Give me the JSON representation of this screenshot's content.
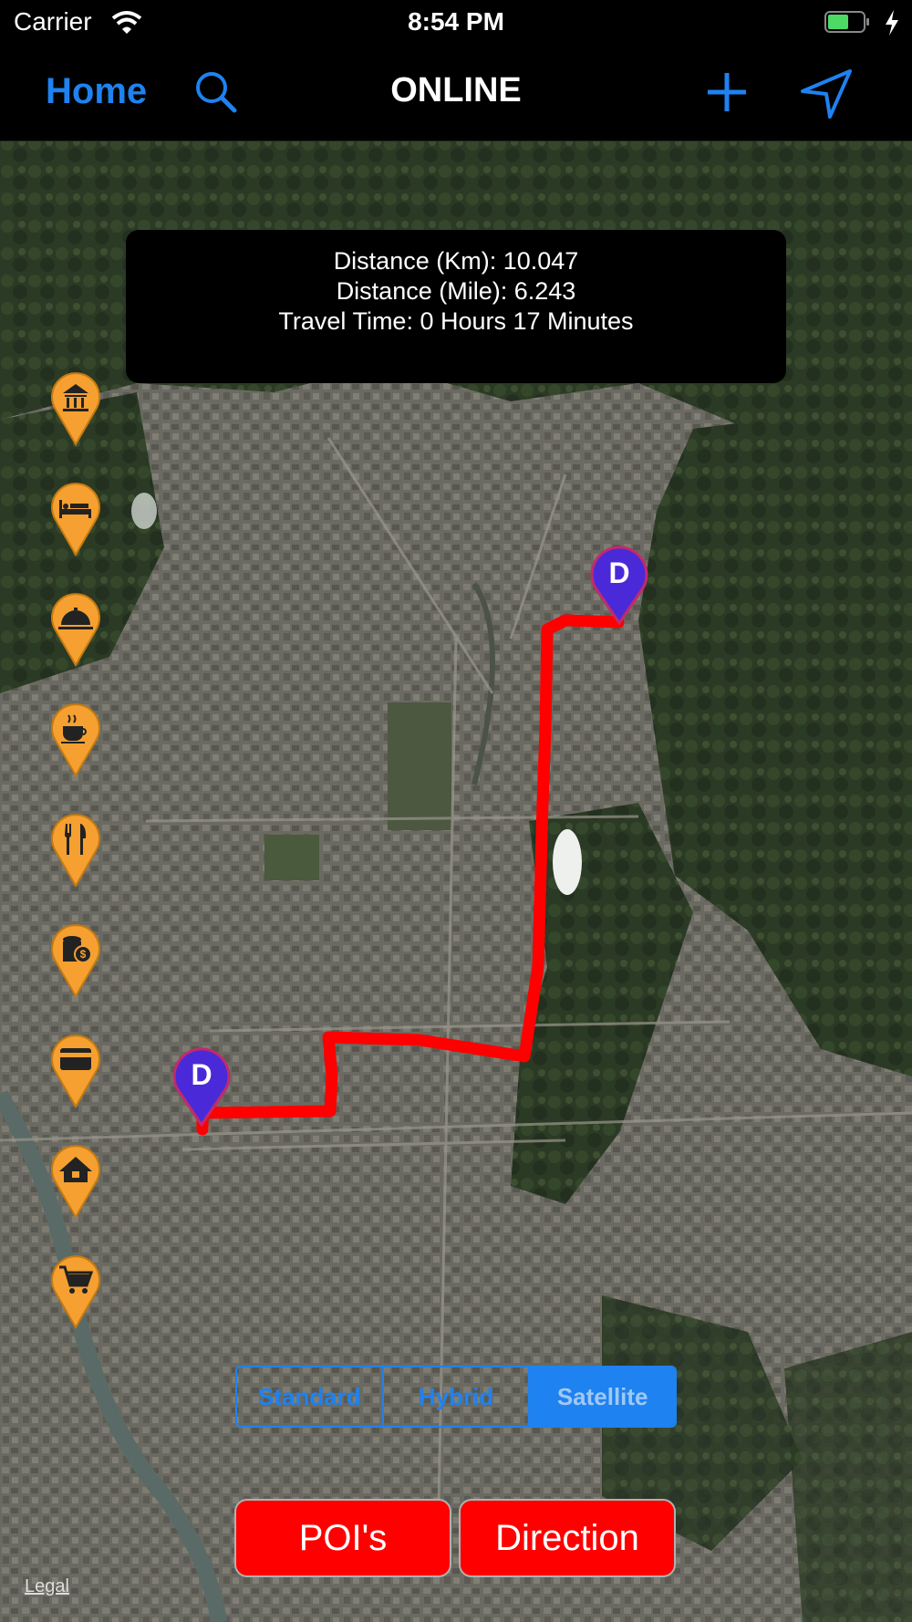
{
  "status_bar": {
    "carrier": "Carrier",
    "time": "8:54 PM"
  },
  "nav": {
    "home_label": "Home",
    "title": "ONLINE"
  },
  "info": {
    "distance_km": "Distance (Km): 10.047",
    "distance_mile": "Distance (Mile): 6.243",
    "travel_time": "Travel Time: 0 Hours 17 Minutes"
  },
  "poi_icons": [
    "museum-icon",
    "hotel-icon",
    "food-cloche-icon",
    "cafe-icon",
    "restaurant-icon",
    "bank-icon",
    "atm-card-icon",
    "home-icon",
    "shopping-cart-icon"
  ],
  "route_markers": [
    "D",
    "D"
  ],
  "map_type": {
    "options": [
      "Standard",
      "Hybrid",
      "Satellite"
    ],
    "selected": "Satellite"
  },
  "buttons": {
    "pois": "POI's",
    "direction": "Direction"
  },
  "legal": "Legal",
  "colors": {
    "accent": "#1e82f0",
    "route": "#ff0000",
    "pin_orange": "#f5a030",
    "marker_purple": "#4a2ad8"
  }
}
